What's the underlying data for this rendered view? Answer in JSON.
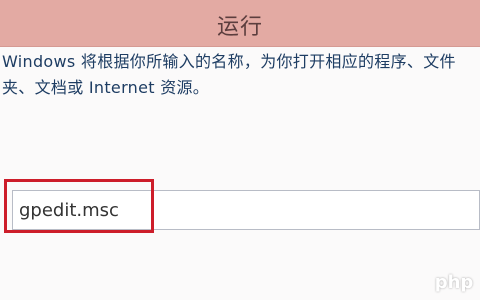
{
  "window": {
    "title": "运行"
  },
  "run_dialog": {
    "description": "Windows 将根据你所输入的名称，为你打开相应的程序、文件夹、文档或 Internet 资源。",
    "input_value": "gpedit.msc"
  },
  "watermark": "php",
  "colors": {
    "titlebar": "#e3aaa3",
    "highlight": "#cd1d2a",
    "text": "#1e3d63"
  }
}
